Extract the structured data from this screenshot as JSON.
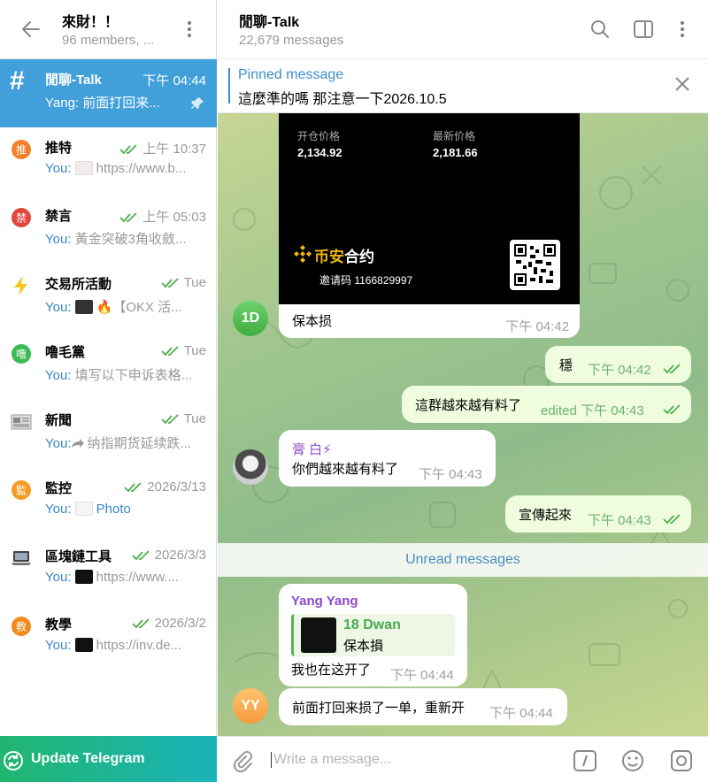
{
  "left_header": {
    "title": "來財！！",
    "subtitle": "96 members, ..."
  },
  "chats": [
    {
      "name": "閒聊-Talk",
      "time": "下午 04:44",
      "sender": "Yang: ",
      "preview": "前面打回来...",
      "active": true
    },
    {
      "name": "推特",
      "time": "上午 10:37",
      "sender": "You: ",
      "preview": "https://www.b...",
      "icon_color": "#f47f2a",
      "icon_char": "推"
    },
    {
      "name": "禁言",
      "time": "上午 05:03",
      "sender": "You: ",
      "preview": "黃金突破3角收斂...",
      "icon_color": "#e0463c",
      "icon_char": "禁"
    },
    {
      "name": "交易所活動",
      "time": "Tue",
      "sender": "You: ",
      "preview": "🔥【OKX 活...",
      "icon_char": "⚡"
    },
    {
      "name": "噜毛黨",
      "time": "Tue",
      "sender": "You: ",
      "preview": "填写以下申诉表格...",
      "icon_color": "#3cba54",
      "icon_char": "噜"
    },
    {
      "name": "新聞",
      "time": "Tue",
      "sender": "You:",
      "preview": "纳指期货延续跌...",
      "icon_char": "新"
    },
    {
      "name": "監控",
      "time": "2026/3/13",
      "sender": "You: ",
      "preview": "Photo",
      "icon_color": "#f59c23",
      "icon_char": "監"
    },
    {
      "name": "區塊鏈工具",
      "time": "2026/3/3",
      "sender": "You: ",
      "preview": "https://www....",
      "icon_char": "區"
    },
    {
      "name": "教學",
      "time": "2026/3/2",
      "sender": "You: ",
      "preview": "https://inv.de...",
      "icon_color": "#f08a1e",
      "icon_char": "教"
    }
  ],
  "update_label": "Update Telegram",
  "right_header": {
    "title": "閒聊-Talk",
    "subtitle": "22,679 messages"
  },
  "pinned": {
    "label": "Pinned message",
    "text": "這麼準的嗎 那注意一下2026.10.5"
  },
  "trade_card": {
    "open_label": "开仓价格",
    "open_value": "2,134.92",
    "latest_label": "最新价格",
    "latest_value": "2,181.66",
    "brand_prefix": "币安",
    "brand_suffix": "合约",
    "invite": "邀请码 1166829997"
  },
  "messages": [
    {
      "id": "m1",
      "avatar": "1D",
      "text": "保本损",
      "time": "下午 04:42"
    },
    {
      "id": "m2",
      "text": "穩",
      "time": "下午 04:42"
    },
    {
      "id": "m3",
      "text": "這群越來越有料了",
      "time": "edited 下午 04:43"
    },
    {
      "id": "m4",
      "sender": "膏 白⚡",
      "text": "你們越來越有料了",
      "time": "下午 04:43"
    },
    {
      "id": "m5",
      "text": "宣傳起來",
      "time": "下午 04:43"
    },
    {
      "id": "m6",
      "sender": "Yang Yang",
      "reply_name": "18 Dwan",
      "reply_text": "保本損",
      "text": "我也在这开了",
      "time": "下午 04:44"
    },
    {
      "id": "m7",
      "avatar": "YY",
      "text": "前面打回来损了一单，重新开",
      "time": "下午 04:44"
    }
  ],
  "unread_label": "Unread messages",
  "composer_placeholder": "Write a message..."
}
